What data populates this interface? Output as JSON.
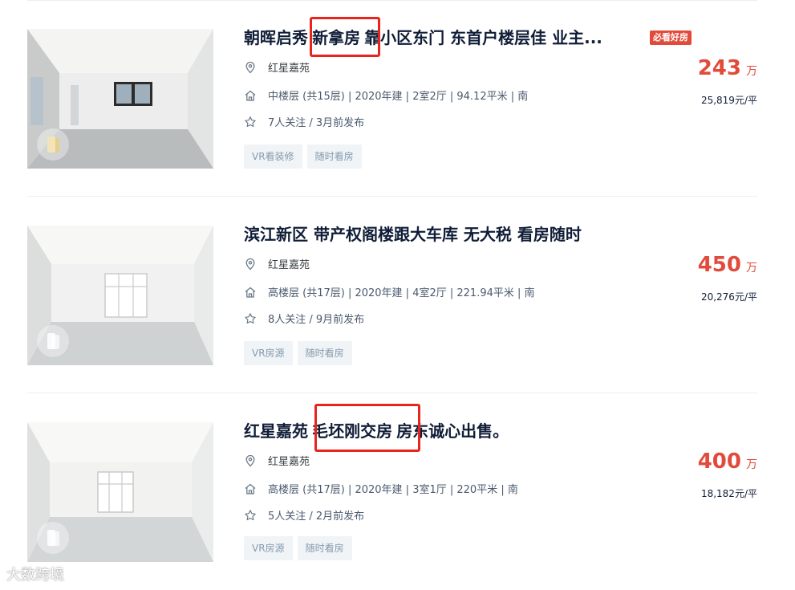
{
  "listings": [
    {
      "title_part1": "朝晖启秀",
      "title_highlight": "新拿房",
      "title_part2": "靠小区东门 东首户楼层佳 业主...",
      "must_see_badge": "必看好房",
      "community": "红星嘉苑",
      "house_info": "中楼层 (共15层) | 2020年建 | 2室2厅 | 94.12平米 | 南",
      "follow_info": "7人关注 / 3月前发布",
      "tags": [
        "VR看装修",
        "随时看房"
      ],
      "total_price": "243",
      "price_unit": "万",
      "unit_price": "25,819元/平"
    },
    {
      "title_part1": "滨江新区 带产权阁楼跟大车库 无大税 看房随时",
      "title_highlight": "",
      "title_part2": "",
      "must_see_badge": "",
      "community": "红星嘉苑",
      "house_info": "高楼层 (共17层) | 2020年建 | 4室2厅 | 221.94平米 | 南",
      "follow_info": "8人关注 / 9月前发布",
      "tags": [
        "VR房源",
        "随时看房"
      ],
      "total_price": "450",
      "price_unit": "万",
      "unit_price": "20,276元/平"
    },
    {
      "title_part1": "红星嘉苑",
      "title_highlight": "毛坯刚交房",
      "title_part2": "房东诚心出售。",
      "must_see_badge": "",
      "community": "红星嘉苑",
      "house_info": "高楼层 (共17层) | 2020年建 | 3室1厅 | 220平米 | 南",
      "follow_info": "5人关注 / 2月前发布",
      "tags": [
        "VR房源",
        "随时看房"
      ],
      "total_price": "400",
      "price_unit": "万",
      "unit_price": "18,182元/平"
    }
  ],
  "icons": {
    "location": "location-pin-icon",
    "house": "house-icon",
    "follow": "star-icon",
    "vr": "vr-icon"
  },
  "colors": {
    "title": "#101d37",
    "price": "#e14b3b",
    "tag_bg": "#f0f4f7",
    "tag_text": "#849aae",
    "highlight_box": "#e8241c"
  },
  "watermark": "大数跨境"
}
